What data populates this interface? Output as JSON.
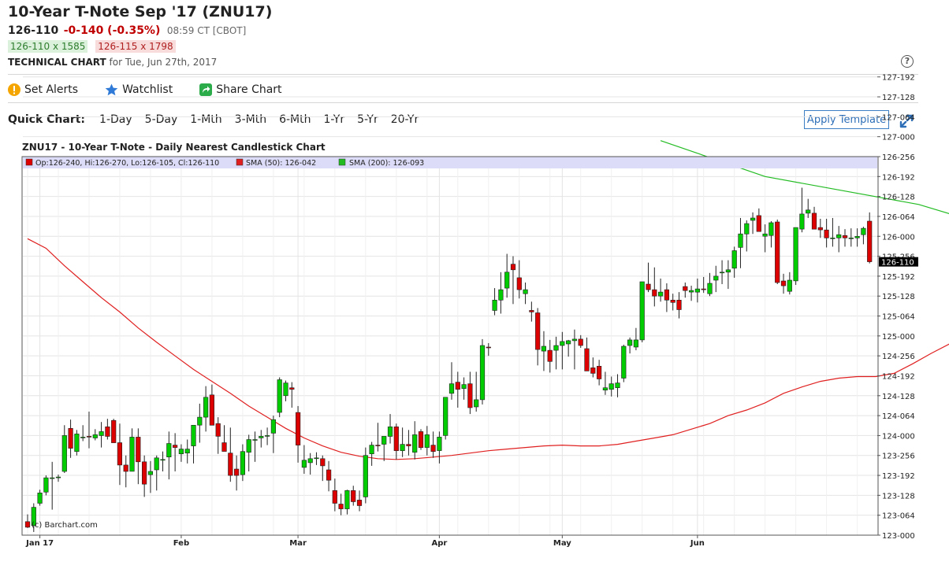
{
  "header": {
    "title": "10-Year T-Note Sep '17 (ZNU17)",
    "last": "126-110",
    "change": "-0-140 (-0.35%)",
    "time": "08:59 CT [CBOT]",
    "bid": "126-110 x 1585",
    "ask": "126-115 x 1798",
    "tech_label": "TECHNICAL CHART",
    "tech_date": "for Tue, Jun 27th, 2017"
  },
  "actions": {
    "alerts": "Set Alerts",
    "watchlist": "Watchlist",
    "share": "Share Chart"
  },
  "quick": {
    "label": "Quick Chart:",
    "timeframes": [
      "1-Day",
      "5-Day",
      "1-Mth",
      "3-Mth",
      "6-Mth",
      "1-Yr",
      "5-Yr",
      "20-Yr"
    ],
    "apply": "Apply Template"
  },
  "colors": {
    "up": "#00cc00",
    "down": "#dd0000",
    "sma50": "#e02020",
    "sma200": "#22bb22",
    "legend_bg": "#dcdcf8"
  },
  "chart_data": {
    "type": "candlestick",
    "title": "ZNU17 - 10-Year T-Note - Daily Nearest Candlestick Chart",
    "legend": {
      "ohlc": "Op:126-240, Hi:126-270, Lo:126-105, Cl:126-110",
      "sma50": "SMA (50): 126-042",
      "sma200": "SMA (200): 126-093"
    },
    "credit": "(c) Barchart.com",
    "last_label": "126-110",
    "x_labels": [
      {
        "label": "Jan 17",
        "index": 2
      },
      {
        "label": "Feb",
        "index": 25
      },
      {
        "label": "Mar",
        "index": 44
      },
      {
        "label": "Apr",
        "index": 67
      },
      {
        "label": "May",
        "index": 87
      },
      {
        "label": "Jun",
        "index": 109
      }
    ],
    "y_ticks": [
      "123-000",
      "123-064",
      "123-128",
      "123-192",
      "123-256",
      "124-000",
      "124-064",
      "124-128",
      "124-192",
      "124-256",
      "125-000",
      "125-064",
      "125-128",
      "125-192",
      "125-256",
      "126-000",
      "126-064",
      "126-128",
      "126-192",
      "126-256",
      "127-000",
      "127-064",
      "127-128",
      "127-192"
    ],
    "y_unit_note": "price in points and 256ths of a point",
    "ylim": [
      123.0,
      127.75
    ],
    "candles": [
      [
        123.17,
        123.26,
        123.09,
        123.1
      ],
      [
        123.12,
        123.4,
        123.04,
        123.35
      ],
      [
        123.4,
        123.57,
        123.37,
        123.53
      ],
      [
        123.54,
        123.75,
        123.5,
        123.72
      ],
      [
        123.72,
        123.92,
        123.32,
        123.72
      ],
      [
        123.72,
        123.76,
        123.67,
        123.73
      ],
      [
        123.8,
        124.38,
        123.78,
        124.25
      ],
      [
        124.34,
        124.45,
        123.97,
        124.09
      ],
      [
        124.05,
        124.32,
        124.0,
        124.27
      ],
      [
        124.23,
        124.38,
        124.18,
        124.23
      ],
      [
        124.24,
        124.55,
        124.09,
        124.23
      ],
      [
        124.22,
        124.33,
        124.19,
        124.26
      ],
      [
        124.25,
        124.42,
        124.1,
        124.3
      ],
      [
        124.36,
        124.46,
        124.2,
        124.24
      ],
      [
        124.44,
        124.46,
        124.22,
        124.16
      ],
      [
        124.16,
        124.4,
        123.63,
        123.88
      ],
      [
        123.88,
        124.0,
        123.6,
        123.8
      ],
      [
        123.8,
        124.34,
        123.8,
        124.23
      ],
      [
        124.23,
        124.34,
        123.64,
        123.92
      ],
      [
        123.92,
        124.0,
        123.48,
        123.64
      ],
      [
        123.76,
        123.93,
        123.53,
        123.8
      ],
      [
        123.82,
        124.0,
        123.56,
        123.97
      ],
      [
        123.95,
        124.05,
        123.8,
        123.95
      ],
      [
        123.98,
        124.3,
        123.7,
        124.15
      ],
      [
        124.13,
        124.28,
        123.8,
        124.1
      ],
      [
        124.02,
        124.14,
        123.92,
        124.08
      ],
      [
        124.03,
        124.2,
        123.9,
        124.08
      ],
      [
        124.12,
        124.38,
        123.9,
        124.38
      ],
      [
        124.38,
        124.65,
        124.16,
        124.48
      ],
      [
        124.48,
        124.87,
        124.3,
        124.73
      ],
      [
        124.76,
        124.89,
        124.5,
        124.38
      ],
      [
        124.4,
        124.48,
        124.02,
        124.24
      ],
      [
        124.16,
        124.38,
        124.06,
        124.05
      ],
      [
        124.03,
        124.35,
        123.67,
        123.75
      ],
      [
        123.83,
        124.0,
        123.56,
        123.75
      ],
      [
        123.76,
        124.14,
        123.68,
        124.05
      ],
      [
        124.04,
        124.26,
        123.8,
        124.2
      ],
      [
        124.19,
        124.3,
        123.92,
        124.2
      ],
      [
        124.22,
        124.32,
        124.1,
        124.24
      ],
      [
        124.24,
        124.35,
        124.13,
        124.25
      ],
      [
        124.28,
        124.5,
        124.03,
        124.45
      ],
      [
        124.54,
        124.98,
        124.48,
        124.95
      ],
      [
        124.75,
        124.94,
        124.68,
        124.91
      ],
      [
        124.85,
        124.92,
        124.6,
        124.83
      ],
      [
        124.54,
        124.62,
        123.91,
        124.13
      ],
      [
        123.85,
        124.13,
        123.77,
        123.94
      ],
      [
        123.91,
        124.03,
        123.76,
        123.96
      ],
      [
        123.96,
        124.04,
        123.88,
        123.97
      ],
      [
        123.96,
        124.0,
        123.68,
        123.87
      ],
      [
        123.82,
        123.93,
        123.55,
        123.69
      ],
      [
        123.56,
        123.71,
        123.3,
        123.4
      ],
      [
        123.39,
        123.52,
        123.25,
        123.33
      ],
      [
        123.33,
        123.57,
        123.26,
        123.56
      ],
      [
        123.56,
        123.62,
        123.37,
        123.42
      ],
      [
        123.44,
        123.56,
        123.3,
        123.37
      ],
      [
        123.48,
        124.1,
        123.4,
        124.0
      ],
      [
        124.02,
        124.17,
        123.87,
        124.13
      ],
      [
        124.13,
        124.41,
        124.05,
        124.12
      ],
      [
        124.14,
        124.23,
        123.93,
        124.24
      ],
      [
        124.24,
        124.52,
        124.15,
        124.36
      ],
      [
        124.36,
        124.4,
        123.95,
        124.06
      ],
      [
        124.06,
        124.35,
        123.98,
        124.14
      ],
      [
        124.14,
        124.32,
        124.0,
        124.12
      ],
      [
        124.04,
        124.43,
        123.95,
        124.26
      ],
      [
        124.3,
        124.33,
        124.07,
        124.1
      ],
      [
        124.1,
        124.37,
        124.0,
        124.26
      ],
      [
        124.13,
        124.3,
        123.97,
        124.05
      ],
      [
        124.06,
        124.3,
        123.9,
        124.23
      ],
      [
        124.25,
        124.6,
        124.2,
        124.73
      ],
      [
        124.78,
        125.17,
        124.7,
        124.9
      ],
      [
        124.92,
        125.05,
        124.6,
        124.83
      ],
      [
        124.84,
        124.98,
        124.7,
        124.89
      ],
      [
        124.9,
        125.05,
        124.52,
        124.6
      ],
      [
        124.61,
        125.05,
        124.55,
        124.7
      ],
      [
        124.7,
        125.46,
        124.64,
        125.38
      ],
      [
        125.36,
        125.41,
        125.25,
        125.35
      ],
      [
        125.82,
        126.1,
        125.76,
        125.95
      ],
      [
        125.95,
        126.3,
        125.78,
        126.08
      ],
      [
        126.1,
        126.53,
        125.98,
        126.3
      ],
      [
        126.4,
        126.5,
        125.9,
        126.33
      ],
      [
        126.23,
        126.45,
        125.97,
        126.08
      ],
      [
        126.03,
        126.17,
        125.9,
        126.08
      ],
      [
        125.82,
        125.93,
        125.68,
        125.8
      ],
      [
        125.79,
        125.85,
        125.13,
        125.33
      ],
      [
        125.31,
        125.56,
        125.06,
        125.37
      ],
      [
        125.32,
        125.45,
        125.04,
        125.18
      ],
      [
        125.32,
        125.49,
        125.08,
        125.38
      ],
      [
        125.38,
        125.55,
        125.08,
        125.43
      ],
      [
        125.4,
        125.45,
        125.24,
        125.44
      ],
      [
        125.44,
        125.58,
        125.08,
        125.46
      ],
      [
        125.46,
        125.51,
        125.35,
        125.38
      ],
      [
        125.34,
        125.48,
        125.09,
        125.06
      ],
      [
        125.1,
        125.23,
        124.98,
        125.03
      ],
      [
        125.12,
        125.2,
        124.88,
        124.96
      ],
      [
        124.82,
        125.05,
        124.76,
        124.85
      ],
      [
        124.83,
        124.99,
        124.74,
        124.9
      ],
      [
        124.85,
        125.02,
        124.73,
        124.91
      ],
      [
        124.97,
        125.39,
        124.92,
        125.37
      ],
      [
        125.38,
        125.48,
        125.28,
        125.45
      ],
      [
        125.36,
        125.6,
        125.32,
        125.45
      ],
      [
        125.45,
        126.17,
        125.42,
        126.18
      ],
      [
        126.15,
        126.42,
        126.05,
        126.08
      ],
      [
        126.08,
        126.36,
        125.87,
        126.0
      ],
      [
        126.0,
        126.22,
        125.93,
        126.05
      ],
      [
        126.08,
        126.16,
        125.8,
        125.95
      ],
      [
        125.95,
        126.03,
        125.82,
        125.92
      ],
      [
        125.95,
        126.05,
        125.72,
        125.83
      ],
      [
        126.12,
        126.17,
        125.98,
        126.07
      ],
      [
        126.05,
        126.13,
        125.94,
        126.07
      ],
      [
        126.05,
        126.22,
        125.92,
        126.09
      ],
      [
        126.09,
        126.24,
        126.04,
        126.08
      ],
      [
        126.03,
        126.29,
        126.0,
        126.16
      ],
      [
        126.2,
        126.38,
        126.05,
        126.25
      ],
      [
        126.3,
        126.45,
        126.15,
        126.3
      ],
      [
        126.3,
        126.45,
        126.09,
        126.33
      ],
      [
        126.35,
        126.62,
        126.23,
        126.57
      ],
      [
        126.61,
        126.98,
        126.35,
        126.78
      ],
      [
        126.78,
        126.95,
        126.56,
        126.91
      ],
      [
        126.95,
        127.05,
        126.78,
        126.98
      ],
      [
        127.01,
        127.1,
        126.88,
        126.81
      ],
      [
        126.75,
        126.9,
        126.55,
        126.78
      ],
      [
        126.76,
        126.94,
        126.61,
        126.92
      ],
      [
        126.93,
        126.96,
        126.15,
        126.17
      ],
      [
        126.19,
        126.28,
        126.03,
        126.13
      ],
      [
        126.06,
        126.3,
        126.02,
        126.2
      ],
      [
        126.19,
        126.85,
        126.14,
        126.86
      ],
      [
        126.84,
        127.36,
        126.8,
        127.03
      ],
      [
        127.04,
        127.22,
        126.98,
        127.08
      ],
      [
        127.04,
        127.12,
        126.85,
        126.84
      ],
      [
        126.86,
        126.97,
        126.73,
        126.83
      ],
      [
        126.83,
        126.97,
        126.61,
        126.73
      ],
      [
        126.73,
        126.98,
        126.62,
        126.73
      ],
      [
        126.73,
        126.88,
        126.55,
        126.77
      ],
      [
        126.76,
        126.84,
        126.62,
        126.73
      ],
      [
        126.73,
        126.85,
        126.62,
        126.73
      ],
      [
        126.73,
        126.85,
        126.62,
        126.75
      ],
      [
        126.77,
        126.87,
        126.65,
        126.85
      ],
      [
        126.94,
        127.05,
        126.41,
        126.43
      ]
    ],
    "sma50": [
      [
        0,
        126.72
      ],
      [
        3,
        126.6
      ],
      [
        6,
        126.38
      ],
      [
        9,
        126.18
      ],
      [
        12,
        125.98
      ],
      [
        15,
        125.8
      ],
      [
        18,
        125.6
      ],
      [
        21,
        125.42
      ],
      [
        24,
        125.25
      ],
      [
        27,
        125.08
      ],
      [
        30,
        124.93
      ],
      [
        33,
        124.78
      ],
      [
        36,
        124.62
      ],
      [
        39,
        124.48
      ],
      [
        42,
        124.34
      ],
      [
        45,
        124.22
      ],
      [
        48,
        124.12
      ],
      [
        51,
        124.04
      ],
      [
        54,
        123.99
      ],
      [
        57,
        123.96
      ],
      [
        60,
        123.95
      ],
      [
        63,
        123.96
      ],
      [
        66,
        123.98
      ],
      [
        69,
        124.0
      ],
      [
        72,
        124.03
      ],
      [
        75,
        124.06
      ],
      [
        78,
        124.08
      ],
      [
        81,
        124.1
      ],
      [
        84,
        124.12
      ],
      [
        87,
        124.13
      ],
      [
        90,
        124.12
      ],
      [
        93,
        124.12
      ],
      [
        96,
        124.14
      ],
      [
        99,
        124.18
      ],
      [
        102,
        124.22
      ],
      [
        105,
        124.26
      ],
      [
        108,
        124.33
      ],
      [
        111,
        124.4
      ],
      [
        114,
        124.5
      ],
      [
        117,
        124.57
      ],
      [
        120,
        124.66
      ],
      [
        123,
        124.78
      ],
      [
        126,
        124.86
      ],
      [
        129,
        124.93
      ],
      [
        132,
        124.97
      ],
      [
        135,
        124.99
      ],
      [
        138,
        124.99
      ],
      [
        141,
        125.03
      ],
      [
        144,
        125.15
      ],
      [
        147,
        125.28
      ],
      [
        150,
        125.4
      ],
      [
        153,
        125.53
      ],
      [
        156,
        125.64
      ],
      [
        159,
        125.73
      ],
      [
        162,
        125.82
      ],
      [
        165,
        125.9
      ],
      [
        168,
        125.99
      ],
      [
        171,
        126.07
      ],
      [
        174,
        126.14
      ],
      [
        177,
        126.2
      ],
      [
        179,
        126.22
      ]
    ],
    "sma200": [
      [
        103,
        127.95
      ],
      [
        120,
        127.5
      ],
      [
        145,
        127.15
      ],
      [
        160,
        126.8
      ],
      [
        170,
        126.55
      ],
      [
        179,
        126.36
      ]
    ]
  }
}
